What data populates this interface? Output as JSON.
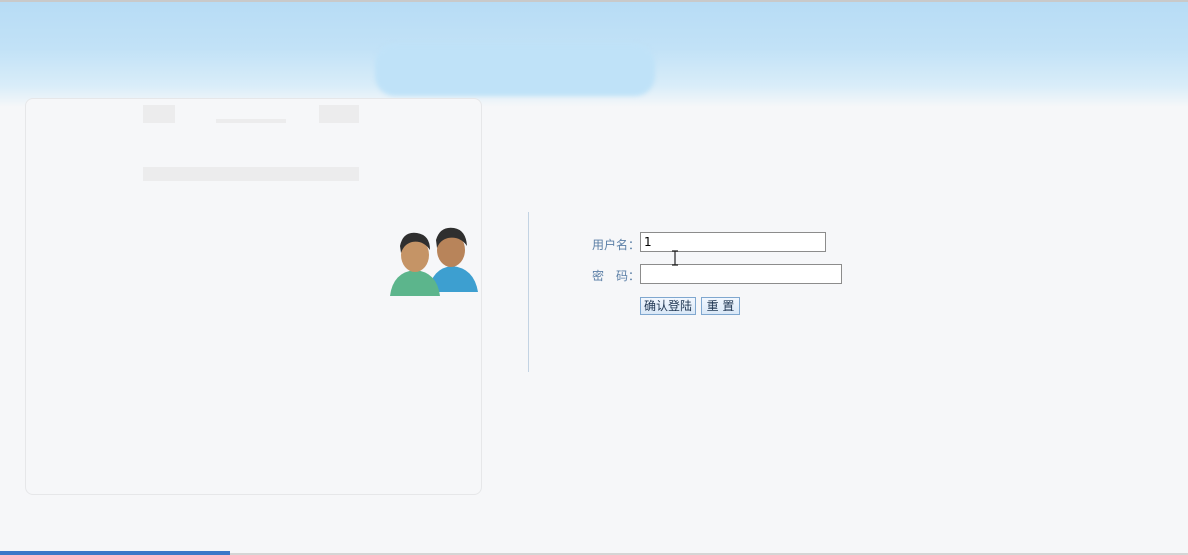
{
  "login": {
    "username_label": "用户名：",
    "username_value": "1",
    "password_label": "密　码：",
    "password_value": "",
    "submit_label": "确认登陆",
    "reset_label": "重 置"
  },
  "icons": {
    "avatar": "users-icon",
    "cursor": "text-cursor-icon"
  }
}
